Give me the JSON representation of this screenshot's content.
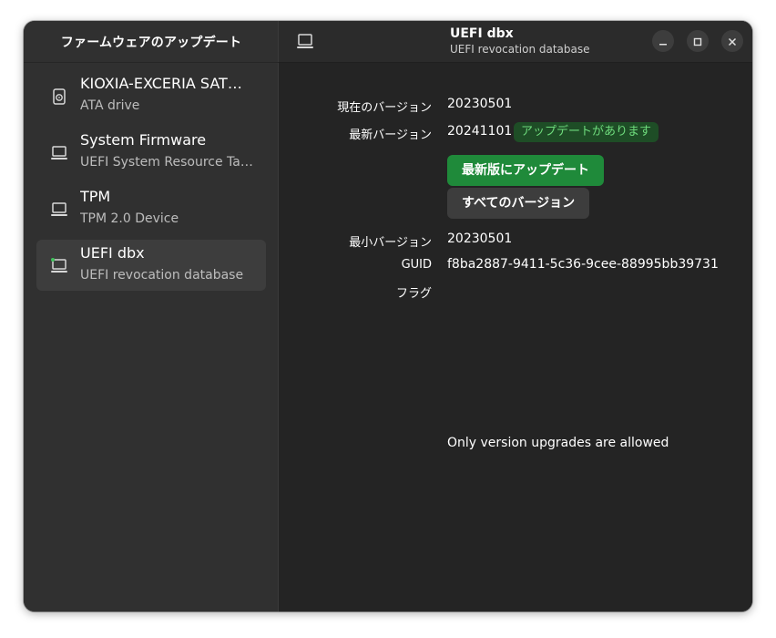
{
  "sidebar": {
    "title": "ファームウェアのアップデート",
    "devices": [
      {
        "name": "KIOXIA-EXCERIA SAT…",
        "desc": "ATA drive",
        "icon": "drive-icon"
      },
      {
        "name": "System Firmware",
        "desc": "UEFI System Resource Ta…",
        "icon": "computer-icon"
      },
      {
        "name": "TPM",
        "desc": "TPM 2.0 Device",
        "icon": "computer-icon"
      },
      {
        "name": "UEFI dbx",
        "desc": "UEFI revocation database",
        "icon": "computer-icon",
        "selected": true
      }
    ]
  },
  "header": {
    "title": "UEFI dbx",
    "subtitle": "UEFI revocation database",
    "device_icon": "computer-icon",
    "controls": [
      "minimize-icon",
      "maximize-icon",
      "close-icon"
    ]
  },
  "details": {
    "current_version_label": "現在のバージョン",
    "current_version": "20230501",
    "latest_version_label": "最新バージョン",
    "latest_version": "20241101",
    "update_badge": "アップデートがあります",
    "update_button": "最新版にアップデート",
    "all_versions_button": "すべてのバージョン",
    "min_version_label": "最小バージョン",
    "min_version": "20230501",
    "guid_label": "GUID",
    "guid": "f8ba2887-9411-5c36-9cee-88995bb39731",
    "flags_label": "フラグ",
    "note": "Only version upgrades are allowed"
  },
  "colors": {
    "accent_green": "#1f8a3a",
    "badge_bg": "#1e4d26",
    "badge_text": "#6fdc7d",
    "window_bg": "#242424",
    "sidebar_bg": "#303030"
  }
}
